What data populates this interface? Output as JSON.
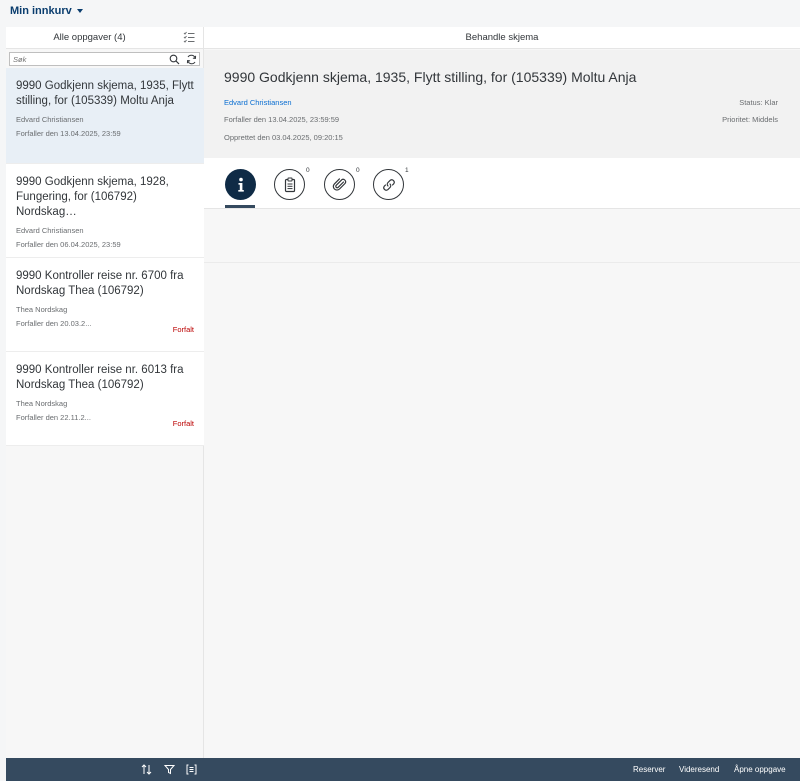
{
  "topbar": {
    "title": "Min innkurv"
  },
  "left": {
    "header": "Alle oppgaver (4)",
    "search_placeholder": "Søk",
    "items": [
      {
        "title": "9990 Godkjenn skjema, 1935, Flytt stilling, for (105339) Moltu Anja",
        "author": "Edvard Christiansen",
        "due": "Forfaller den 13.04.2025, 23:59",
        "status": ""
      },
      {
        "title": "9990 Godkjenn skjema, 1928, Fungering, for (106792) Nordskag…",
        "author": "Edvard Christiansen",
        "due": "Forfaller den 06.04.2025, 23:59",
        "status": ""
      },
      {
        "title": "9990 Kontroller reise nr. 6700 fra Nordskag Thea (106792)",
        "author": "Thea Nordskag",
        "due": "Forfaller den 20.03.2...",
        "status": "Forfalt"
      },
      {
        "title": "9990 Kontroller reise nr. 6013 fra Nordskag Thea (106792)",
        "author": "Thea Nordskag",
        "due": "Forfaller den 22.11.2...",
        "status": "Forfalt"
      }
    ],
    "footer_icons": [
      "sort-icon",
      "filter-icon",
      "group-icon"
    ]
  },
  "right": {
    "header": "Behandle skjema",
    "title": "9990 Godkjenn skjema, 1935, Flytt stilling, for (105339) Moltu Anja",
    "author": "Edvard Christiansen",
    "due": "Forfaller den 13.04.2025, 23:59:59",
    "created": "Opprettet den 03.04.2025, 09:20:15",
    "status": "Status: Klar",
    "priority": "Prioritet: Middels",
    "tabs": [
      {
        "icon": "info-icon",
        "count": ""
      },
      {
        "icon": "notes-icon",
        "count": "0"
      },
      {
        "icon": "attachment-icon",
        "count": "0"
      },
      {
        "icon": "link-icon",
        "count": "1"
      }
    ],
    "footer": {
      "reserve": "Reserver",
      "forward": "Videresend",
      "open": "Åpne oppgave"
    }
  }
}
